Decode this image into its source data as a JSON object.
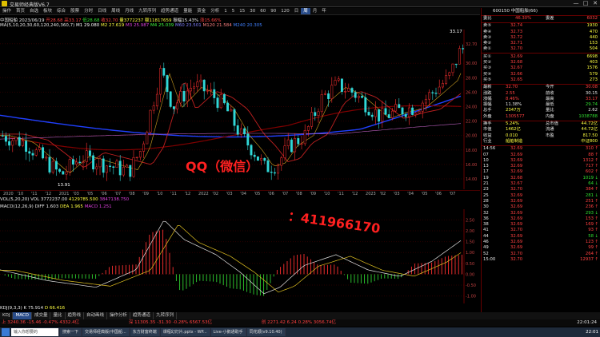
{
  "window": {
    "title": "交易师经典版V6.7",
    "min_label": "—",
    "max_label": "□",
    "close_label": "✕"
  },
  "toolbar": {
    "items": [
      "操作",
      "首页",
      "自选",
      "板块",
      "综合",
      "股票",
      "分时",
      "日线",
      "周线",
      "月线",
      "九转序列",
      "趋势通道",
      "量能",
      "资金",
      "分析",
      "1",
      "5",
      "15",
      "30",
      "60",
      "90",
      "120",
      "日",
      "周",
      "月",
      "年"
    ],
    "selected_index": 23
  },
  "info": {
    "stock": "中国船舶",
    "date_label": "2023/06/19",
    "open": "开28.68",
    "high": "高33.17",
    "low": "低28.68",
    "close": "收32.70",
    "volume": "量3772237",
    "amount": "额11817659",
    "amp": "振幅15.43%",
    "chg": "涨15.66%"
  },
  "ma": {
    "label": "MA(5,10,20,30,60,120,240,360,7)",
    "items": [
      {
        "text": "M1 29.080",
        "color": "#ffffff"
      },
      {
        "text": "M2 27.619",
        "color": "#ffff40"
      },
      {
        "text": "M3 25.987",
        "color": "#e040e0"
      },
      {
        "text": "M4 25.039",
        "color": "#40ff40"
      },
      {
        "text": "M60 23.501",
        "color": "#8080ff"
      },
      {
        "text": "M120 21.584",
        "color": "#ff8080"
      },
      {
        "text": "M240 20.305",
        "color": "#4080ff"
      }
    ]
  },
  "chart": {
    "price_high_label": "33.17",
    "price_low_label": "13.91",
    "axis_right": [
      "32.70",
      "30.00",
      "28.00",
      "26.00",
      "24.00",
      "22.00",
      "20.00",
      "18.00",
      "16.00",
      "14.00"
    ],
    "dates": [
      "2020",
      "'10",
      "'11",
      "'12",
      "2021",
      "'03",
      "'05",
      "'06",
      "'07",
      "'08",
      "'09",
      "'10",
      "'11",
      "'12",
      "2022",
      "'02",
      "'03",
      "'04",
      "'05",
      "'06",
      "'07",
      "'08",
      "'09",
      "'10",
      "'11",
      "'12",
      "2023",
      "'02",
      "'03",
      "'04",
      "'05",
      "'06",
      "'07"
    ]
  },
  "vol": {
    "label": "VOL(5,20,20)",
    "v1": "VOL 3772237.00",
    "v2": "4129785.500",
    "v3": "3847138.750"
  },
  "macd": {
    "label": "MACD(12,26,9)",
    "diff": "DIFF 1.603",
    "dea": "DEA 1.965",
    "macd": "MACD 1.251",
    "axis": [
      "2.50",
      "2.00",
      "1.50",
      "1.00",
      "0.50",
      "0.00",
      "-0.50",
      "-1.00"
    ]
  },
  "kdj": {
    "label": "KDJ(9,3,3)",
    "k": "K 75.914",
    "d": "D 66.416"
  },
  "watermark": {
    "line1": "QQ（微信）",
    "line2": "：411966170"
  },
  "bottom_tabs": {
    "items": [
      "KDJ",
      "MACD",
      "成交量",
      "量比",
      "趋势线",
      "自动画线",
      "操作分析",
      "趋势通道",
      "九转序列"
    ],
    "selected_index": 1
  },
  "status": {
    "sh": "上 3240.36 -15.46 -0.47% 4332.4亿",
    "sz": "深 11305.35 -31.30 -0.28% 6567.53亿",
    "cy": "创 2271.42 6.24 0.28% 3056.74亿",
    "time": "22:01:24"
  },
  "panel": {
    "code": "600150",
    "name": "中国船舶(66)",
    "ratio_label": "委比",
    "ratio_val": "46.30%",
    "diff_label": "委差",
    "diff_val": "6032",
    "sells": [
      {
        "label": "卖⑤",
        "price": "32.74",
        "vol": "1930"
      },
      {
        "label": "卖④",
        "price": "32.73",
        "vol": "470"
      },
      {
        "label": "卖③",
        "price": "32.72",
        "vol": "440"
      },
      {
        "label": "卖②",
        "price": "32.71",
        "vol": "153"
      },
      {
        "label": "卖①",
        "price": "32.70",
        "vol": "504"
      }
    ],
    "buys": [
      {
        "label": "买①",
        "price": "32.69",
        "vol": "6698"
      },
      {
        "label": "买②",
        "price": "32.68",
        "vol": "403"
      },
      {
        "label": "买③",
        "price": "32.67",
        "vol": "1576"
      },
      {
        "label": "买④",
        "price": "32.66",
        "vol": "579"
      },
      {
        "label": "买⑤",
        "price": "32.65",
        "vol": "273"
      }
    ],
    "stats": [
      {
        "l1": "最新",
        "v1": "32.70",
        "l2": "今开",
        "v2": "30.08",
        "c1": "red",
        "c2": "red"
      },
      {
        "l1": "涨跌",
        "v1": "2.55",
        "l2": "前收",
        "v2": "30.15",
        "c1": "red",
        "c2": "white"
      },
      {
        "l1": "涨幅",
        "v1": "8.46%",
        "l2": "最高",
        "v2": "33.17",
        "c1": "red",
        "c2": "red"
      },
      {
        "l1": "振幅",
        "v1": "11.38%",
        "l2": "最低",
        "v2": "29.74",
        "c1": "white",
        "c2": "green"
      },
      {
        "l1": "总手",
        "v1": "2347万",
        "l2": "量比",
        "v2": "2.62",
        "c1": "yellow",
        "c2": "white"
      },
      {
        "l1": "外盘",
        "v1": "1305577",
        "l2": "内盘",
        "v2": "1038788",
        "c1": "red",
        "c2": "green"
      }
    ],
    "stats2": [
      {
        "l1": "换手",
        "v1": "5.24%",
        "l2": "总市值",
        "v2": "44.72亿"
      },
      {
        "l1": "市值",
        "v1": "1462亿",
        "l2": "流通",
        "v2": "44.72亿"
      },
      {
        "l1": "收益",
        "v1": "0.010",
        "l2": "市盈",
        "v2": "817.50"
      },
      {
        "l1": "行业",
        "v1": "船舶制造",
        "l2": "",
        "v2": "中证800"
      }
    ],
    "ticks": [
      {
        "t": "14:56",
        "p": "32.69",
        "v": "310",
        "d": "up"
      },
      {
        "t": "07",
        "p": "32.69",
        "v": "88",
        "d": "up"
      },
      {
        "t": "10",
        "p": "32.69",
        "v": "1312",
        "d": "up"
      },
      {
        "t": "13",
        "p": "32.69",
        "v": "717",
        "d": "up"
      },
      {
        "t": "17",
        "p": "32.69",
        "v": "602",
        "d": "up"
      },
      {
        "t": "19",
        "p": "32.68",
        "v": "1019",
        "d": "dn"
      },
      {
        "t": "21",
        "p": "32.67",
        "v": "64",
        "d": "dn"
      },
      {
        "t": "23",
        "p": "32.70",
        "v": "384",
        "d": "up"
      },
      {
        "t": "25",
        "p": "32.69",
        "v": "281",
        "d": "dn"
      },
      {
        "t": "28",
        "p": "32.69",
        "v": "251",
        "d": "up"
      },
      {
        "t": "30",
        "p": "32.69",
        "v": "236",
        "d": "up"
      },
      {
        "t": "32",
        "p": "32.69",
        "v": "293",
        "d": "dn"
      },
      {
        "t": "36",
        "p": "32.69",
        "v": "153",
        "d": "up"
      },
      {
        "t": "38",
        "p": "32.69",
        "v": "169",
        "d": "up"
      },
      {
        "t": "41",
        "p": "32.70",
        "v": "93",
        "d": "up"
      },
      {
        "t": "44",
        "p": "32.69",
        "v": "58",
        "d": "dn"
      },
      {
        "t": "46",
        "p": "32.69",
        "v": "123",
        "d": "up"
      },
      {
        "t": "49",
        "p": "32.69",
        "v": "99",
        "d": "up"
      },
      {
        "t": "52",
        "p": "32.70",
        "v": "264",
        "d": "up"
      },
      {
        "t": "15:00",
        "p": "32.70",
        "v": "12937",
        "d": "up"
      }
    ]
  },
  "taskbar": {
    "start": "输入你想要的",
    "items": [
      "搜索一下",
      "交易师经典版(中国船...",
      "东方财富终端",
      "课程幻灯片.pptx - WP...",
      "Live-小鹅通助手",
      "同花顺(v9.10.40)"
    ],
    "clock": "22:01"
  }
}
